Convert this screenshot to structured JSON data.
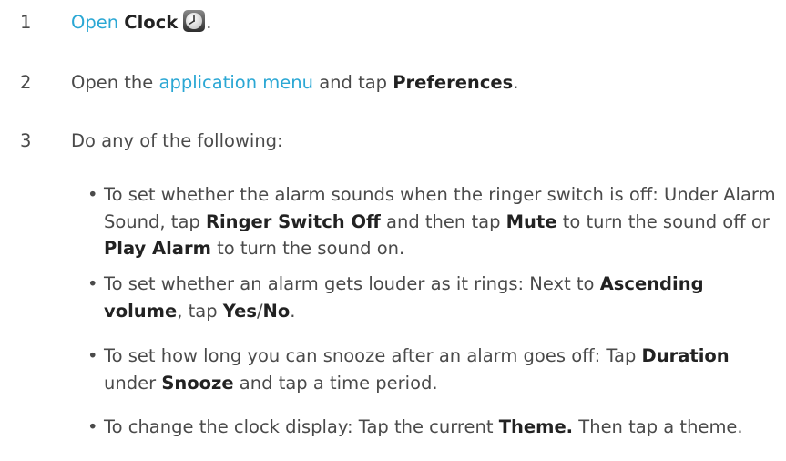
{
  "steps": [
    {
      "number": "1",
      "open_link": "Open",
      "app_name": "Clock",
      "period": ".",
      "icon": "clock-icon"
    },
    {
      "number": "2",
      "prefix": "Open the",
      "menu_link": "application menu",
      "middle": "and tap",
      "target": "Preferences",
      "period": "."
    },
    {
      "number": "3",
      "text": "Do any of the following:"
    }
  ],
  "bullets": [
    {
      "marker": "•",
      "t1": "To set whether the alarm sounds when the ringer switch is off: Under Alarm Sound, tap ",
      "b1": "Ringer Switch Off",
      "t2": " and then tap ",
      "b2": "Mute",
      "t3": " to turn the sound off or ",
      "b3": "Play Alarm",
      "t4": " to turn the sound on."
    },
    {
      "marker": "•",
      "t1": "To set whether an alarm gets louder as it rings: Next to ",
      "b1": "Ascending volume",
      "t2": ", tap ",
      "b2": "Yes",
      "t3": "/",
      "b3": "No",
      "t4": "."
    },
    {
      "marker": "•",
      "t1": "To set how long you can snooze after an alarm goes off: Tap ",
      "b1": "Duration",
      "t2": " under ",
      "b2": "Snooze",
      "t3": " and tap a time period."
    },
    {
      "marker": "•",
      "t1": "To change the clock display: Tap the current ",
      "b1": "Theme.",
      "t2": " Then tap a theme."
    }
  ]
}
